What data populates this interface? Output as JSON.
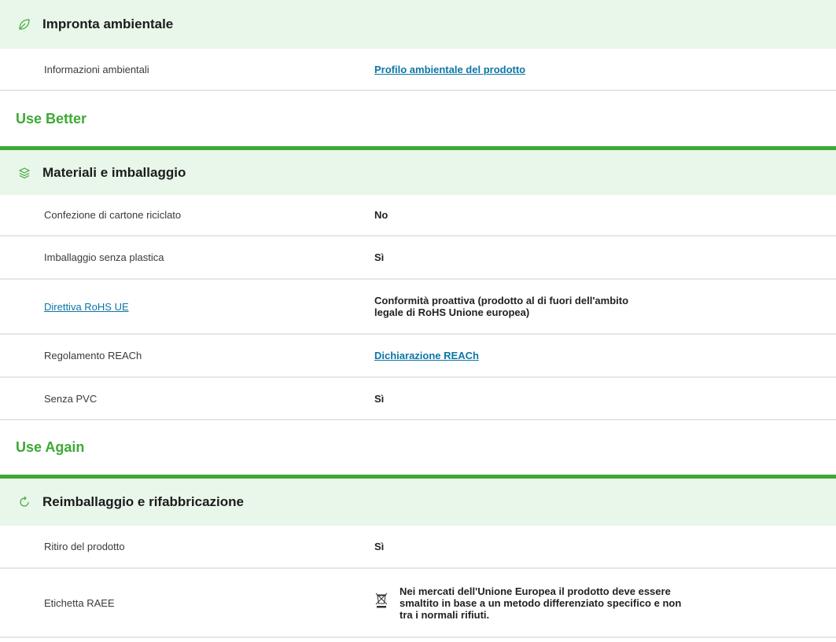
{
  "environmental_footprint": {
    "title": "Impronta ambientale",
    "icon": "leaf-icon",
    "rows": [
      {
        "label": "Informazioni ambientali",
        "value": "Profilo ambientale del prodotto"
      }
    ]
  },
  "use_better": {
    "category": "Use Better",
    "section": {
      "title": "Materiali e imballaggio",
      "icon": "layers-icon",
      "rows": [
        {
          "label": "Confezione di cartone riciclato",
          "value": "No"
        },
        {
          "label": "Imballaggio senza plastica",
          "value": "Sì"
        },
        {
          "label": "Direttiva RoHS UE",
          "value_line1": "Conformità proattiva (prodotto al di fuori dell'ambito",
          "value_line2": "legale di RoHS Unione europea)"
        },
        {
          "label": "Regolamento REACh",
          "value": "Dichiarazione REACh"
        },
        {
          "label": "Senza PVC",
          "value": "Sì"
        }
      ]
    }
  },
  "use_again": {
    "category": "Use Again",
    "section": {
      "title": "Reimballaggio e rifabbricazione",
      "icon": "refresh-icon",
      "rows": [
        {
          "label": "Ritiro del prodotto",
          "value": "Sì"
        },
        {
          "label": "Etichetta RAEE",
          "value_line1": "Nei mercati dell'Unione Europea il prodotto deve essere",
          "value_line2": "smaltito in base a un metodo differenziato specifico e non",
          "value_line3": "tra i normali rifiuti.",
          "icon": "crossed-bin-icon"
        }
      ]
    }
  },
  "colors": {
    "accent_green": "#3da935",
    "header_bg": "#e9f6ea",
    "link_blue": "#0d76a5",
    "divider": "#e6e6e6"
  }
}
